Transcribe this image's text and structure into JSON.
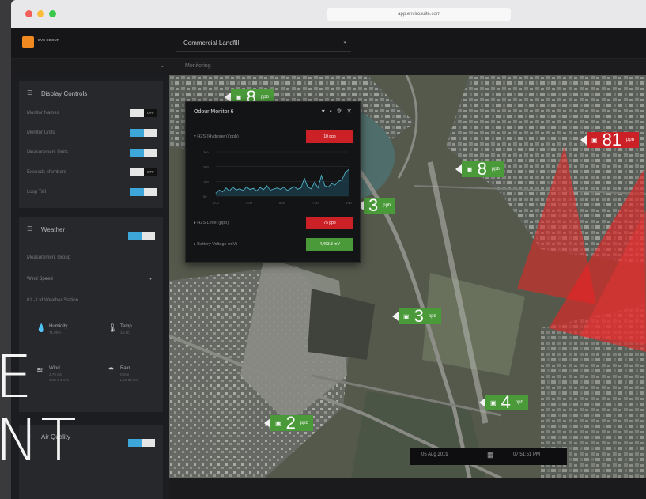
{
  "browser": {
    "url": "app.envirosuite.com"
  },
  "app": {
    "logo_text": "EVS ODOUR",
    "site": "Commercial Landfill",
    "breadcrumb": "Monitoring"
  },
  "display_controls": {
    "title": "Display Controls",
    "items": [
      {
        "label": "Monitor Names",
        "state": "off",
        "state_label": "OFF"
      },
      {
        "label": "Monitor Units",
        "state": "on",
        "state_label": "ON"
      },
      {
        "label": "Measurement Units",
        "state": "on",
        "state_label": "ON"
      },
      {
        "label": "Exceeds Members",
        "state": "off",
        "state_label": "OFF"
      },
      {
        "label": "Loop Tail",
        "state": "on",
        "state_label": "ON"
      }
    ]
  },
  "weather": {
    "title": "Weather",
    "toggle_label": "ON",
    "measurement_label": "Measurement Group",
    "measurement_value": "Wind Speed",
    "station_label": "01 - Ltd Weather Station",
    "readings": [
      {
        "label": "Humidity",
        "value": "71.00%",
        "icon": "humidity-icon"
      },
      {
        "label": "Temp",
        "value": "16.4C",
        "icon": "temp-icon"
      },
      {
        "label": "Wind",
        "value": "2.79 m/s",
        "icon": "wind-icon",
        "extra": "SSE 0.1 m/s"
      },
      {
        "label": "Rain",
        "value": "0 mm",
        "icon": "rain-icon",
        "extra": "Last 24 hrs"
      }
    ]
  },
  "air_quality": {
    "title": "Air Quality",
    "toggle_label": "ON"
  },
  "popup": {
    "title": "Odour Monitor 6",
    "rows": [
      {
        "label": "H2S (Hydrogen)(ppb)",
        "value": "10 ppb",
        "color": "#cc2027"
      },
      {
        "label": "H2S Level (ppb)",
        "value": "75 ppb",
        "color": "#cc2027"
      },
      {
        "label": "Battery Voltage (mV)",
        "value": "4,463.3 mV",
        "color": "#4a9a3a"
      }
    ],
    "y_ticks": [
      "300",
      "200",
      "100",
      "50"
    ],
    "x_ticks": [
      "4:00",
      "5:00",
      "6:00",
      "7:00",
      "8:00"
    ]
  },
  "chart_data": {
    "type": "line",
    "x": [
      0,
      1,
      2,
      3,
      4,
      5,
      6,
      7,
      8,
      9,
      10,
      11,
      12,
      13,
      14,
      15,
      16,
      17,
      18,
      19,
      20,
      21,
      22,
      23,
      24,
      25,
      26,
      27,
      28,
      29,
      30,
      31,
      32,
      33,
      34,
      35,
      36,
      37,
      38,
      39
    ],
    "series": [
      {
        "values": [
          20,
          40,
          30,
          55,
          35,
          60,
          42,
          50,
          38,
          62,
          45,
          52,
          36,
          58,
          44,
          70,
          40,
          48,
          55,
          46,
          60,
          38,
          52,
          64,
          47,
          56,
          120,
          60,
          50,
          95,
          55,
          140,
          70,
          62,
          85,
          75,
          100,
          110,
          160,
          180
        ]
      }
    ],
    "title": "",
    "xlabel": "",
    "ylabel": "",
    "ylim": [
      0,
      300
    ]
  },
  "markers": [
    {
      "value": "8",
      "unit": "ppb",
      "color": "green"
    },
    {
      "value": "81",
      "unit": "ppb",
      "color": "red"
    },
    {
      "value": "8",
      "unit": "ppb",
      "color": "green"
    },
    {
      "value": "3",
      "unit": "ppb",
      "color": "green"
    },
    {
      "value": "3",
      "unit": "ppb",
      "color": "green"
    },
    {
      "value": "4",
      "unit": "ppb",
      "color": "green"
    },
    {
      "value": "2",
      "unit": "ppb",
      "color": "green"
    }
  ],
  "datebar": {
    "date": "05 Aug 2019",
    "time": "07:51:51 PM"
  },
  "overlay": {
    "line1": "E",
    "line2": "NT"
  }
}
